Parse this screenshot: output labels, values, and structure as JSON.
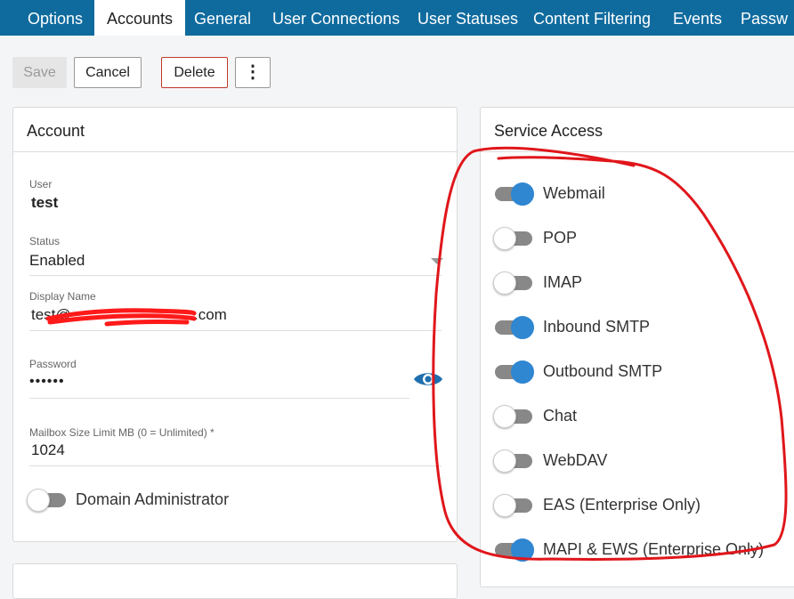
{
  "tabs": [
    "Options",
    "Accounts",
    "General",
    "User Connections",
    "User Statuses",
    "Content Filtering",
    "Events",
    "Passw"
  ],
  "toolbar": {
    "save": "Save",
    "cancel": "Cancel",
    "delete": "Delete",
    "more": "⋮"
  },
  "account": {
    "title": "Account",
    "user_label": "User",
    "user_value": "test",
    "status_label": "Status",
    "status_value": "Enabled",
    "display_name_label": "Display Name",
    "display_name_prefix": "test@",
    "display_name_suffix": ".com",
    "password_label": "Password",
    "password_value": "••••••",
    "mailbox_label": "Mailbox Size Limit MB (0 = Unlimited) *",
    "mailbox_value": "1024",
    "domain_admin_label": "Domain Administrator",
    "domain_admin_on": false
  },
  "service_access": {
    "title": "Service Access",
    "items": [
      {
        "label": "Webmail",
        "on": true
      },
      {
        "label": "POP",
        "on": false
      },
      {
        "label": "IMAP",
        "on": false
      },
      {
        "label": "Inbound SMTP",
        "on": true
      },
      {
        "label": "Outbound SMTP",
        "on": true
      },
      {
        "label": "Chat",
        "on": false
      },
      {
        "label": "WebDAV",
        "on": false
      },
      {
        "label": "EAS (Enterprise Only)",
        "on": false
      },
      {
        "label": "MAPI & EWS (Enterprise Only)",
        "on": true
      }
    ]
  },
  "colors": {
    "tabbar": "#0f6b9e",
    "accent": "#2f86d1",
    "annotation": "#e0161b",
    "redaction": "#ff1a1a"
  }
}
